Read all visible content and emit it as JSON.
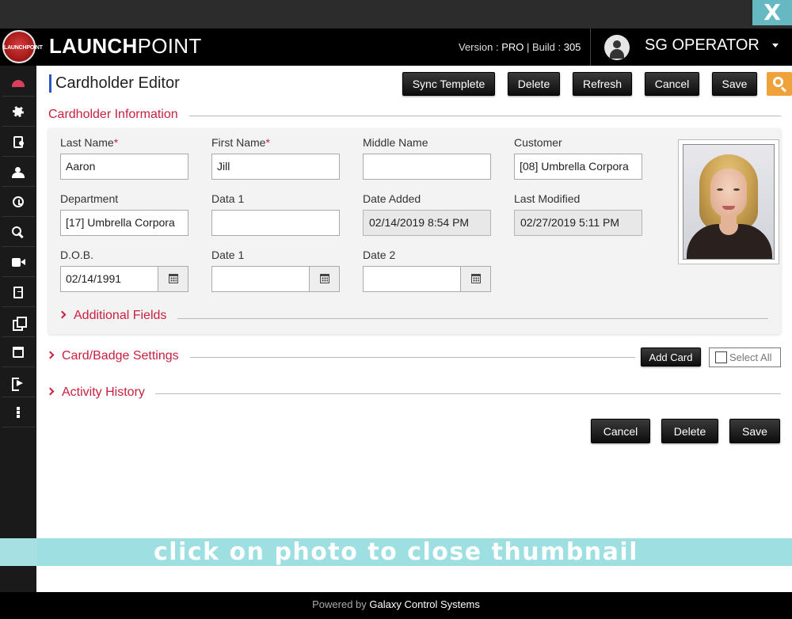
{
  "window": {
    "close_label": "X"
  },
  "header": {
    "logo_text": "LAUNCHPOINT",
    "brand_bold": "LAUNCH",
    "brand_light": "POINT",
    "version_label": "Version : ",
    "version_value": "PRO",
    "build_label": " | Build : ",
    "build_value": "305",
    "username": "SG OPERATOR"
  },
  "sidebar": {
    "items": [
      {
        "icon": "dashboard-icon",
        "active": true
      },
      {
        "icon": "gear-icon"
      },
      {
        "icon": "id-card-icon"
      },
      {
        "icon": "users-icon"
      },
      {
        "icon": "clock-icon"
      },
      {
        "icon": "key-icon"
      },
      {
        "icon": "video-camera-icon"
      },
      {
        "icon": "document-icon"
      },
      {
        "icon": "copy-icon"
      },
      {
        "icon": "calendar-icon"
      },
      {
        "icon": "sign-out-icon"
      },
      {
        "icon": "more-vertical-icon"
      }
    ]
  },
  "page": {
    "title": "Cardholder Editor",
    "toolbar": {
      "sync": "Sync Templete",
      "delete": "Delete",
      "refresh": "Refresh",
      "cancel": "Cancel",
      "save": "Save"
    }
  },
  "cardholder_info": {
    "heading": "Cardholder Information",
    "fields": {
      "last_name": {
        "label": "Last Name",
        "required": "*",
        "value": "Aaron"
      },
      "first_name": {
        "label": "First Name",
        "required": "*",
        "value": "Jill"
      },
      "middle_name": {
        "label": "Middle Name",
        "value": ""
      },
      "customer": {
        "label": "Customer",
        "value": "[08] Umbrella Corpora"
      },
      "department": {
        "label": "Department",
        "value": "[17] Umbrella Corpora"
      },
      "data1": {
        "label": "Data 1",
        "value": ""
      },
      "date_added": {
        "label": "Date Added",
        "value": "02/14/2019 8:54 PM"
      },
      "last_modified": {
        "label": "Last Modified",
        "value": "02/27/2019 5:11 PM"
      },
      "dob": {
        "label": "D.O.B.",
        "value": "02/14/1991"
      },
      "date1": {
        "label": "Date 1",
        "value": ""
      },
      "date2": {
        "label": "Date 2",
        "value": ""
      }
    },
    "additional_fields": "Additional Fields"
  },
  "card_settings": {
    "heading": "Card/Badge Settings",
    "add_card": "Add Card",
    "select_all": "Select All"
  },
  "activity": {
    "heading": "Activity History"
  },
  "bottom_actions": {
    "cancel": "Cancel",
    "delete": "Delete",
    "save": "Save"
  },
  "banner": {
    "text": "click on photo to close thumbnail"
  },
  "footer": {
    "powered_by": "Powered by ",
    "company": "Galaxy Control Systems"
  },
  "colors": {
    "accent": "#c8203e",
    "header_bg": "#000000",
    "search_button": "#f0a23a",
    "banner": "#a6e0e2"
  }
}
